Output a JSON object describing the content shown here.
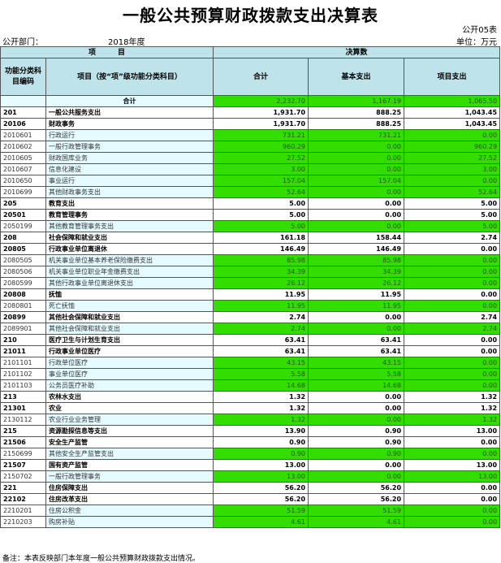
{
  "title": "一般公共预算财政拨款支出决算表",
  "form_no": "公开05表",
  "dept_label": "公开部门：",
  "year": "2018年度",
  "unit": "单位：万元",
  "header": {
    "item": "项　　　目",
    "result": "决算数",
    "code": "功能分类科目编码",
    "name": "项目（按“项”级功能分类科目）",
    "total": "合计",
    "basic": "基本支出",
    "project": "项目支出"
  },
  "total_row": {
    "label": "合计",
    "total": "2,232.70",
    "basic": "1,167.19",
    "project": "1,065.50"
  },
  "rows": [
    {
      "code": "201",
      "name": "一般公共服务支出",
      "total": "1,931.70",
      "basic": "888.25",
      "project": "1,043.45",
      "level": 1
    },
    {
      "code": "20106",
      "name": "财政事务",
      "total": "1,931.70",
      "basic": "888.25",
      "project": "1,043.45",
      "level": 2
    },
    {
      "code": "2010601",
      "name": "行政运行",
      "total": "731.21",
      "basic": "731.21",
      "project": "0.00",
      "level": 3
    },
    {
      "code": "2010602",
      "name": "一般行政管理事务",
      "total": "960.29",
      "basic": "0.00",
      "project": "960.29",
      "level": 3
    },
    {
      "code": "2010605",
      "name": "财政国库业务",
      "total": "27.52",
      "basic": "0.00",
      "project": "27.52",
      "level": 3
    },
    {
      "code": "2010607",
      "name": "信息化建设",
      "total": "3.00",
      "basic": "0.00",
      "project": "3.00",
      "level": 3
    },
    {
      "code": "2010650",
      "name": "事业运行",
      "total": "157.04",
      "basic": "157.04",
      "project": "0.00",
      "level": 3
    },
    {
      "code": "2010699",
      "name": "其他财政事务支出",
      "total": "52.64",
      "basic": "0.00",
      "project": "52.64",
      "level": 3
    },
    {
      "code": "205",
      "name": "教育支出",
      "total": "5.00",
      "basic": "0.00",
      "project": "5.00",
      "level": 1
    },
    {
      "code": "20501",
      "name": "教育管理事务",
      "total": "5.00",
      "basic": "0.00",
      "project": "5.00",
      "level": 2
    },
    {
      "code": "2050199",
      "name": "其他教育管理事务支出",
      "total": "5.00",
      "basic": "0.00",
      "project": "5.00",
      "level": 3
    },
    {
      "code": "208",
      "name": "社会保障和就业支出",
      "total": "161.18",
      "basic": "158.44",
      "project": "2.74",
      "level": 1
    },
    {
      "code": "20805",
      "name": "行政事业单位离退休",
      "total": "146.49",
      "basic": "146.49",
      "project": "0.00",
      "level": 2
    },
    {
      "code": "2080505",
      "name": "机关事业单位基本养老保险缴费支出",
      "total": "85.98",
      "basic": "85.98",
      "project": "0.00",
      "level": 3
    },
    {
      "code": "2080506",
      "name": "机关事业单位职业年金缴费支出",
      "total": "34.39",
      "basic": "34.39",
      "project": "0.00",
      "level": 3
    },
    {
      "code": "2080599",
      "name": "其他行政事业单位离退休支出",
      "total": "26.12",
      "basic": "26.12",
      "project": "0.00",
      "level": 3
    },
    {
      "code": "20808",
      "name": "抚恤",
      "total": "11.95",
      "basic": "11.95",
      "project": "0.00",
      "level": 2
    },
    {
      "code": "2080801",
      "name": "死亡抚恤",
      "total": "11.95",
      "basic": "11.95",
      "project": "0.00",
      "level": 3
    },
    {
      "code": "20899",
      "name": "其他社会保障和就业支出",
      "total": "2.74",
      "basic": "0.00",
      "project": "2.74",
      "level": 2
    },
    {
      "code": "2089901",
      "name": "其他社会保障和就业支出",
      "total": "2.74",
      "basic": "0.00",
      "project": "2.74",
      "level": 3
    },
    {
      "code": "210",
      "name": "医疗卫生与计划生育支出",
      "total": "63.41",
      "basic": "63.41",
      "project": "0.00",
      "level": 1
    },
    {
      "code": "21011",
      "name": "行政事业单位医疗",
      "total": "63.41",
      "basic": "63.41",
      "project": "0.00",
      "level": 2
    },
    {
      "code": "2101101",
      "name": "行政单位医疗",
      "total": "43.15",
      "basic": "43.15",
      "project": "0.00",
      "level": 3
    },
    {
      "code": "2101102",
      "name": "事业单位医疗",
      "total": "5.58",
      "basic": "5.58",
      "project": "0.00",
      "level": 3
    },
    {
      "code": "2101103",
      "name": "公务员医疗补助",
      "total": "14.68",
      "basic": "14.68",
      "project": "0.00",
      "level": 3
    },
    {
      "code": "213",
      "name": "农林水支出",
      "total": "1.32",
      "basic": "0.00",
      "project": "1.32",
      "level": 1
    },
    {
      "code": "21301",
      "name": "农业",
      "total": "1.32",
      "basic": "0.00",
      "project": "1.32",
      "level": 2
    },
    {
      "code": "2130112",
      "name": "农业行业业务管理",
      "total": "1.32",
      "basic": "0.00",
      "project": "1.32",
      "level": 3
    },
    {
      "code": "215",
      "name": "资源勘探信息等支出",
      "total": "13.90",
      "basic": "0.90",
      "project": "13.00",
      "level": 1
    },
    {
      "code": "21506",
      "name": "安全生产监管",
      "total": "0.90",
      "basic": "0.90",
      "project": "0.00",
      "level": 2
    },
    {
      "code": "2150699",
      "name": "其他安全生产监管支出",
      "total": "0.90",
      "basic": "0.90",
      "project": "0.00",
      "level": 3
    },
    {
      "code": "21507",
      "name": "国有资产监管",
      "total": "13.00",
      "basic": "0.00",
      "project": "13.00",
      "level": 2
    },
    {
      "code": "2150702",
      "name": "一般行政管理事务",
      "total": "13.00",
      "basic": "0.00",
      "project": "13.00",
      "level": 3
    },
    {
      "code": "221",
      "name": "住房保障支出",
      "total": "56.20",
      "basic": "56.20",
      "project": "0.00",
      "level": 1
    },
    {
      "code": "22102",
      "name": "住房改革支出",
      "total": "56.20",
      "basic": "56.20",
      "project": "0.00",
      "level": 2
    },
    {
      "code": "2210201",
      "name": "住房公积金",
      "total": "51.59",
      "basic": "51.59",
      "project": "0.00",
      "level": 3
    },
    {
      "code": "2210203",
      "name": "购房补贴",
      "total": "4.61",
      "basic": "4.61",
      "project": "0.00",
      "level": 3
    }
  ],
  "note": "备注：本表反映部门本年度一般公共预算财政拨款支出情况。"
}
